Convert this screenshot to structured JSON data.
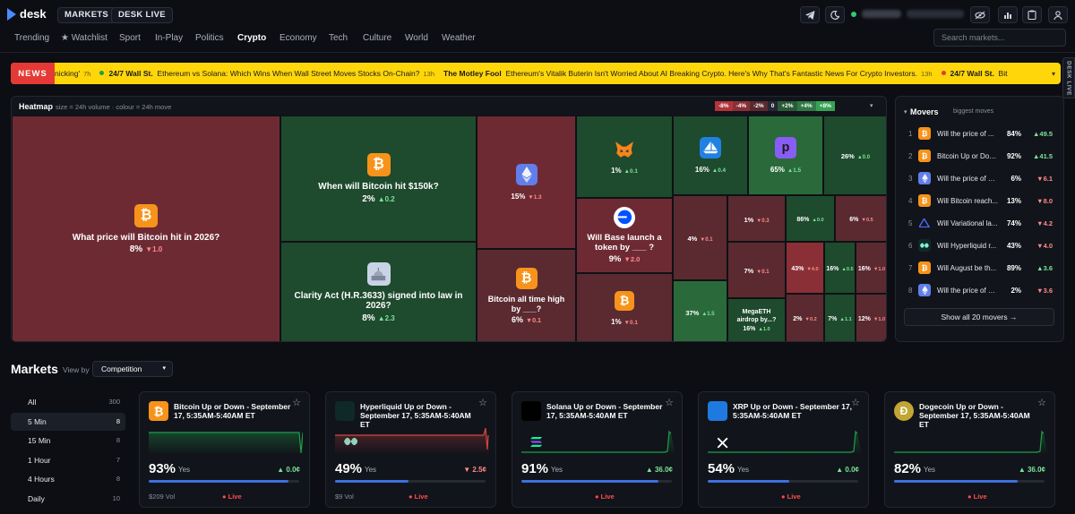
{
  "app": {
    "name": "desk"
  },
  "header": {
    "markets_label": "MARKETS",
    "desk_live_label": "DESK LIVE",
    "search_placeholder": "Search markets..."
  },
  "nav": [
    "Trending",
    "★ Watchlist",
    "Sport",
    "In-Play",
    "Politics",
    "Crypto",
    "Economy",
    "Tech",
    "Culture",
    "World",
    "Weather"
  ],
  "nav_active": "Crypto",
  "news": {
    "tag": "NEWS",
    "items": [
      {
        "source": "",
        "text": "nicking'",
        "age": "7h",
        "dot": "green"
      },
      {
        "source": "24/7 Wall St.",
        "text": "Ethereum vs Solana: Which Wins When Wall Street Moves Stocks On-Chain?",
        "age": "13h",
        "dot": ""
      },
      {
        "source": "The Motley Fool",
        "text": "Ethereum's Vitalik Buterin Isn't Worried About AI Breaking Crypto. Here's Why That's Fantastic News For Crypto Investors.",
        "age": "13h",
        "dot": "red"
      },
      {
        "source": "24/7 Wall St.",
        "text": "Bit",
        "age": "",
        "dot": ""
      }
    ]
  },
  "side_tab": "DESK LIVE",
  "heatmap": {
    "title": "Heatmap",
    "subtitle": "size = 24h volume · colour = 24h move",
    "legend": [
      "-8%",
      "-4%",
      "-2%",
      "0",
      "+2%",
      "+4%",
      "+8%"
    ],
    "legend_colors": [
      "#b2343b",
      "#8a2f36",
      "#5a2a30",
      "#242833",
      "#2a5b38",
      "#2f7a44",
      "#36a354"
    ],
    "cells": [
      {
        "title": "What price will Bitcoin hit in 2026?",
        "pct": "8%",
        "chg": "▼1.0",
        "dir": "dn",
        "icon": "btc",
        "color": "#6e2a33"
      },
      {
        "title": "When will Bitcoin hit $150k?",
        "pct": "2%",
        "chg": "▲0.2",
        "dir": "up",
        "icon": "btc",
        "color": "#1e4a2d"
      },
      {
        "title": "Clarity Act (H.R.3633) signed into law in 2026?",
        "pct": "8%",
        "chg": "▲2.3",
        "dir": "up",
        "icon": "capitol",
        "color": "#1e4a2d"
      },
      {
        "title": "",
        "pct": "15%",
        "chg": "▼1.3",
        "dir": "dn",
        "icon": "eth",
        "color": "#6e2a33"
      },
      {
        "title": "Bitcoin all time high by ___?",
        "pct": "6%",
        "chg": "▼0.1",
        "dir": "dn",
        "icon": "btc",
        "color": "#5a2a30"
      },
      {
        "title": "",
        "pct": "1%",
        "chg": "▲0.1",
        "dir": "up",
        "icon": "fox",
        "color": "#1e4a2d"
      },
      {
        "title": "Will Base launch a token by ___ ?",
        "pct": "9%",
        "chg": "▼2.0",
        "dir": "dn",
        "icon": "base",
        "color": "#6e2a33"
      },
      {
        "title": "",
        "pct": "1%",
        "chg": "▼0.1",
        "dir": "dn",
        "icon": "btc",
        "color": "#5a2a30"
      },
      {
        "title": "",
        "pct": "16%",
        "chg": "▲0.4",
        "dir": "up",
        "icon": "opensea",
        "color": "#1e4a2d"
      },
      {
        "title": "",
        "pct": "65%",
        "chg": "▲1.5",
        "dir": "up",
        "icon": "pump",
        "color": "#2a6a3a"
      },
      {
        "title": "",
        "pct": "26%",
        "chg": "▲0.0",
        "dir": "up",
        "icon": "",
        "color": "#1e4a2d"
      },
      {
        "title": "",
        "pct": "4%",
        "chg": "▼0.1",
        "dir": "dn",
        "icon": "",
        "color": "#5a2a30"
      },
      {
        "title": "",
        "pct": "1%",
        "chg": "▼0.3",
        "dir": "dn",
        "icon": "",
        "color": "#5a2a30"
      },
      {
        "title": "",
        "pct": "86%",
        "chg": "▲0.0",
        "dir": "up",
        "icon": "",
        "color": "#1e4a2d"
      },
      {
        "title": "",
        "pct": "6%",
        "chg": "▼0.5",
        "dir": "dn",
        "icon": "",
        "color": "#5a2a30"
      },
      {
        "title": "",
        "pct": "7%",
        "chg": "▼0.1",
        "dir": "dn",
        "icon": "",
        "color": "#5a2a30"
      },
      {
        "title": "",
        "pct": "43%",
        "chg": "▼4.0",
        "dir": "dn",
        "icon": "",
        "color": "#8a2f36"
      },
      {
        "title": "",
        "pct": "16%",
        "chg": "▲0.5",
        "dir": "up",
        "icon": "",
        "color": "#1e4a2d"
      },
      {
        "title": "",
        "pct": "16%",
        "chg": "▼1.0",
        "dir": "dn",
        "icon": "",
        "color": "#5a2a30"
      },
      {
        "title": "",
        "pct": "37%",
        "chg": "▲1.5",
        "dir": "up",
        "icon": "",
        "color": "#2a6a3a"
      },
      {
        "title": "MegaETH airdrop by...?",
        "pct": "16%",
        "chg": "▲1.0",
        "dir": "up",
        "icon": "",
        "color": "#1e4a2d"
      },
      {
        "title": "",
        "pct": "2%",
        "chg": "▼0.2",
        "dir": "dn",
        "icon": "",
        "color": "#5a2a30"
      },
      {
        "title": "",
        "pct": "7%",
        "chg": "▲1.1",
        "dir": "up",
        "icon": "",
        "color": "#1e4a2d"
      },
      {
        "title": "",
        "pct": "12%",
        "chg": "▼1.0",
        "dir": "dn",
        "icon": "",
        "color": "#5a2a30"
      }
    ]
  },
  "movers": {
    "title": "Movers",
    "subtitle": "biggest moves",
    "items": [
      {
        "rank": "1",
        "icon": "btc",
        "title": "Will the price of ...",
        "pct": "84%",
        "chg": "▲49.5",
        "dir": "up"
      },
      {
        "rank": "2",
        "icon": "btc",
        "title": "Bitcoin Up or Dow...",
        "pct": "92%",
        "chg": "▲41.5",
        "dir": "up"
      },
      {
        "rank": "3",
        "icon": "eth",
        "title": "Will the price of Et...",
        "pct": "6%",
        "chg": "▼6.1",
        "dir": "dn"
      },
      {
        "rank": "4",
        "icon": "btc",
        "title": "Will Bitcoin reach...",
        "pct": "13%",
        "chg": "▼8.0",
        "dir": "dn"
      },
      {
        "rank": "5",
        "icon": "variational",
        "title": "Will Variational la...",
        "pct": "74%",
        "chg": "▼4.2",
        "dir": "dn"
      },
      {
        "rank": "6",
        "icon": "hyperliquid",
        "title": "Will Hyperliquid r...",
        "pct": "43%",
        "chg": "▼4.0",
        "dir": "dn"
      },
      {
        "rank": "7",
        "icon": "btc",
        "title": "Will August be th...",
        "pct": "89%",
        "chg": "▲3.6",
        "dir": "up"
      },
      {
        "rank": "8",
        "icon": "eth",
        "title": "Will the price of Et...",
        "pct": "2%",
        "chg": "▼3.6",
        "dir": "dn"
      }
    ],
    "show_all": "Show all 20 movers →"
  },
  "markets": {
    "title": "Markets",
    "view_by_label": "View by",
    "view_by_value": "Competition",
    "filters": [
      {
        "label": "All",
        "count": "300"
      },
      {
        "label": "5 Min",
        "count": "8"
      },
      {
        "label": "15 Min",
        "count": "8"
      },
      {
        "label": "1 Hour",
        "count": "7"
      },
      {
        "label": "4 Hours",
        "count": "8"
      },
      {
        "label": "Daily",
        "count": "10"
      }
    ],
    "active_filter": "5 Min",
    "cards": [
      {
        "title": "Bitcoin Up or Down - September 17, 5:35AM-5:40AM ET",
        "icon": "btc",
        "pct": "93%",
        "yes": "Yes",
        "chg": "▲ 0.0¢",
        "dir": "up",
        "fill": 0.93,
        "vol": "$209 Vol",
        "live": "Live",
        "line": "#1e9e4a",
        "spark": "flat_drop"
      },
      {
        "title": "Hyperliquid Up or Down - September 17, 5:35AM-5:40AM ET",
        "icon": "hyperliquid",
        "pct": "49%",
        "yes": "Yes",
        "chg": "▼ 2.5¢",
        "dir": "dn",
        "fill": 0.49,
        "vol": "$9 Vol",
        "live": "Live",
        "line": "#d64545",
        "spark": "flat_spike"
      },
      {
        "title": "Solana Up or Down - September 17, 5:35AM-5:40AM ET",
        "icon": "sol",
        "pct": "91%",
        "yes": "Yes",
        "chg": "▲ 36.0¢",
        "dir": "up",
        "fill": 0.91,
        "vol": "",
        "live": "Live",
        "line": "#1e9e4a",
        "spark": "low_rise"
      },
      {
        "title": "XRP Up or Down - September 17, 5:35AM-5:40AM ET",
        "icon": "xrp",
        "pct": "54%",
        "yes": "Yes",
        "chg": "▲ 0.0¢",
        "dir": "up",
        "fill": 0.54,
        "vol": "",
        "live": "Live",
        "line": "#1e9e4a",
        "spark": "low_rise"
      },
      {
        "title": "Dogecoin Up or Down - September 17, 5:35AM-5:40AM ET",
        "icon": "doge",
        "pct": "82%",
        "yes": "Yes",
        "chg": "▲ 36.0¢",
        "dir": "up",
        "fill": 0.82,
        "vol": "",
        "live": "Live",
        "line": "#1e9e4a",
        "spark": "low_rise"
      }
    ]
  }
}
